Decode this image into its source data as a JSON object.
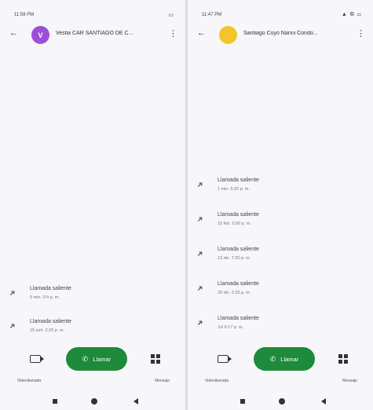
{
  "left_screen": {
    "status": {
      "time": "11:58 PM",
      "icons": "▭"
    },
    "contact": {
      "initial": "V",
      "name": "Vestia CAR SANTIAGO DE C...",
      "avatar_color": "#9b4fd6"
    },
    "calls": [
      {
        "title": "Llamada saliente",
        "detail": "9 min. 0 h p. m."
      },
      {
        "title": "Llamada saliente",
        "detail": "15 seh. 2:20 p. m."
      }
    ],
    "actions": {
      "call_label": "Llamar",
      "left_label": "Videollamada",
      "right_label": "Mensaje"
    }
  },
  "right_screen": {
    "status": {
      "time": "11:47 PM",
      "icons": "▲ ⧉ ▭"
    },
    "contact": {
      "initial": "",
      "name": "Santiago Cuyo Nanni Condo...",
      "avatar_color": "#f0c62c"
    },
    "calls": [
      {
        "title": "Llamada saliente",
        "detail": "1 min. 5:20 p. m."
      },
      {
        "title": "Llamada saliente",
        "detail": "15 feb. 2:00 p. m."
      },
      {
        "title": "Llamada saliente",
        "detail": "13 dic. 7:20 p. m."
      },
      {
        "title": "Llamada saliente",
        "detail": "20 dic. 3:33 p. m."
      },
      {
        "title": "Llamada saliente",
        "detail": "Jul 9:17 p. m."
      }
    ],
    "actions": {
      "call_label": "Llamar",
      "left_label": "Videollamada",
      "right_label": "Mensaje"
    }
  }
}
